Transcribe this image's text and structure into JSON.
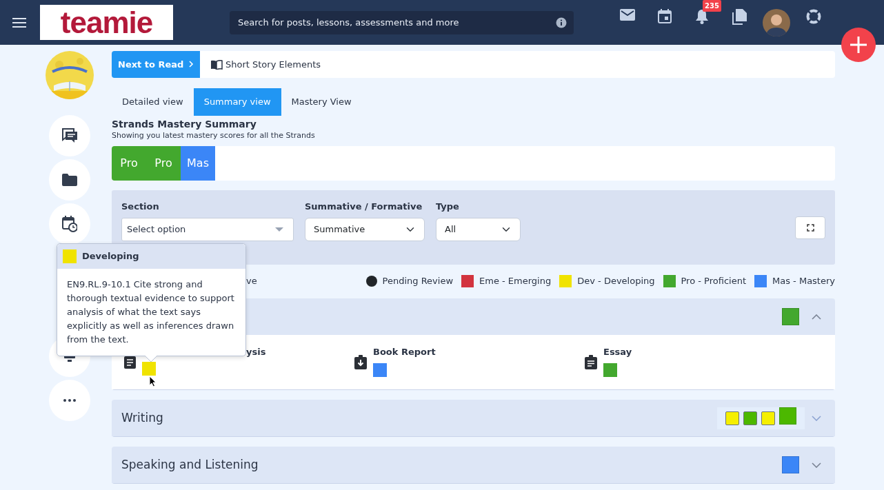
{
  "header": {
    "logo": "teamie",
    "search": {
      "placeholder": "Search for posts, lessons, assessments and more"
    },
    "notification_count": "235"
  },
  "next_to_read": {
    "button": "Next to Read",
    "lesson": "Short Story Elements"
  },
  "tabs": [
    {
      "label": "Detailed view",
      "selected": false
    },
    {
      "label": "Summary view",
      "selected": true
    },
    {
      "label": "Mastery View",
      "selected": false
    }
  ],
  "summary": {
    "title": "Strands Mastery Summary",
    "subtitle": "Showing you latest mastery scores for all the Strands",
    "segments": [
      {
        "label": "Pro",
        "color": "#43a82e"
      },
      {
        "label": "Pro",
        "color": "#43a82e"
      },
      {
        "label": "Mas",
        "color": "#3b86f7"
      }
    ]
  },
  "filters": [
    {
      "label": "Section",
      "kind": "search-select",
      "value": "Select option"
    },
    {
      "label": "Summative / Formative",
      "kind": "select",
      "value": "Summative"
    },
    {
      "label": "Type",
      "kind": "select",
      "value": "All"
    }
  ],
  "legend": {
    "leading_text": "ve",
    "items": [
      {
        "label": "Pending Review",
        "kind": "dot",
        "color": "#212529"
      },
      {
        "label": "Eme - Emerging",
        "kind": "square",
        "color": "#d2343e"
      },
      {
        "label": "Dev - Developing",
        "kind": "square",
        "color": "#f0e300"
      },
      {
        "label": "Pro - Proficient",
        "kind": "square",
        "color": "#43a82e"
      },
      {
        "label": "Mas - Mastery",
        "kind": "square",
        "color": "#3b86f7"
      }
    ]
  },
  "strands": [
    {
      "expanded": true,
      "overall": {
        "color": "#43a82e"
      },
      "assessments": [
        {
          "title": "ysis",
          "kind": "document",
          "color": "#f0e300"
        },
        {
          "title": "Book Report",
          "kind": "submission",
          "color": "#3b86f7"
        },
        {
          "title": "Essay",
          "kind": "clipboard",
          "color": "#43a82e"
        }
      ]
    },
    {
      "title": "Writing",
      "expanded": false,
      "overall": {
        "color": "#4cb800"
      },
      "attempts": [
        {
          "color": "#f5ef00"
        },
        {
          "color": "#4cb800"
        },
        {
          "color": "#f5ef00"
        }
      ]
    },
    {
      "title": "Speaking and Listening",
      "expanded": false,
      "overall": {
        "color": "#3b86f7"
      }
    }
  ],
  "tooltip": {
    "title": "Developing",
    "color": "#f0e300",
    "text": "EN9.RL.9-10.1 Cite strong and thorough textual evidence to support analysis of what the text says explicitly as well as inferences drawn from the text."
  }
}
